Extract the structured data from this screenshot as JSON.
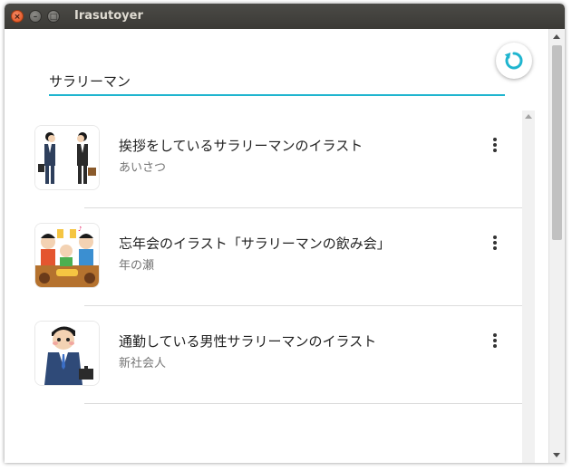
{
  "window": {
    "title": "Irasutoyer",
    "close_glyph": "×",
    "minimize_glyph": "–",
    "maximize_glyph": "□"
  },
  "toolbar": {
    "refresh_icon": "refresh-icon",
    "accent_color": "#1fb5cf"
  },
  "search": {
    "value": "サラリーマン"
  },
  "results": [
    {
      "title": "挨拶をしているサラリーマンのイラスト",
      "category": "あいさつ",
      "thumbnail_icon": "bowing-salarymen-icon"
    },
    {
      "title": "忘年会のイラスト「サラリーマンの飲み会」",
      "category": "年の瀬",
      "thumbnail_icon": "drinking-party-icon"
    },
    {
      "title": "通勤している男性サラリーマンのイラスト",
      "category": "新社会人",
      "thumbnail_icon": "commuting-salaryman-icon"
    }
  ]
}
